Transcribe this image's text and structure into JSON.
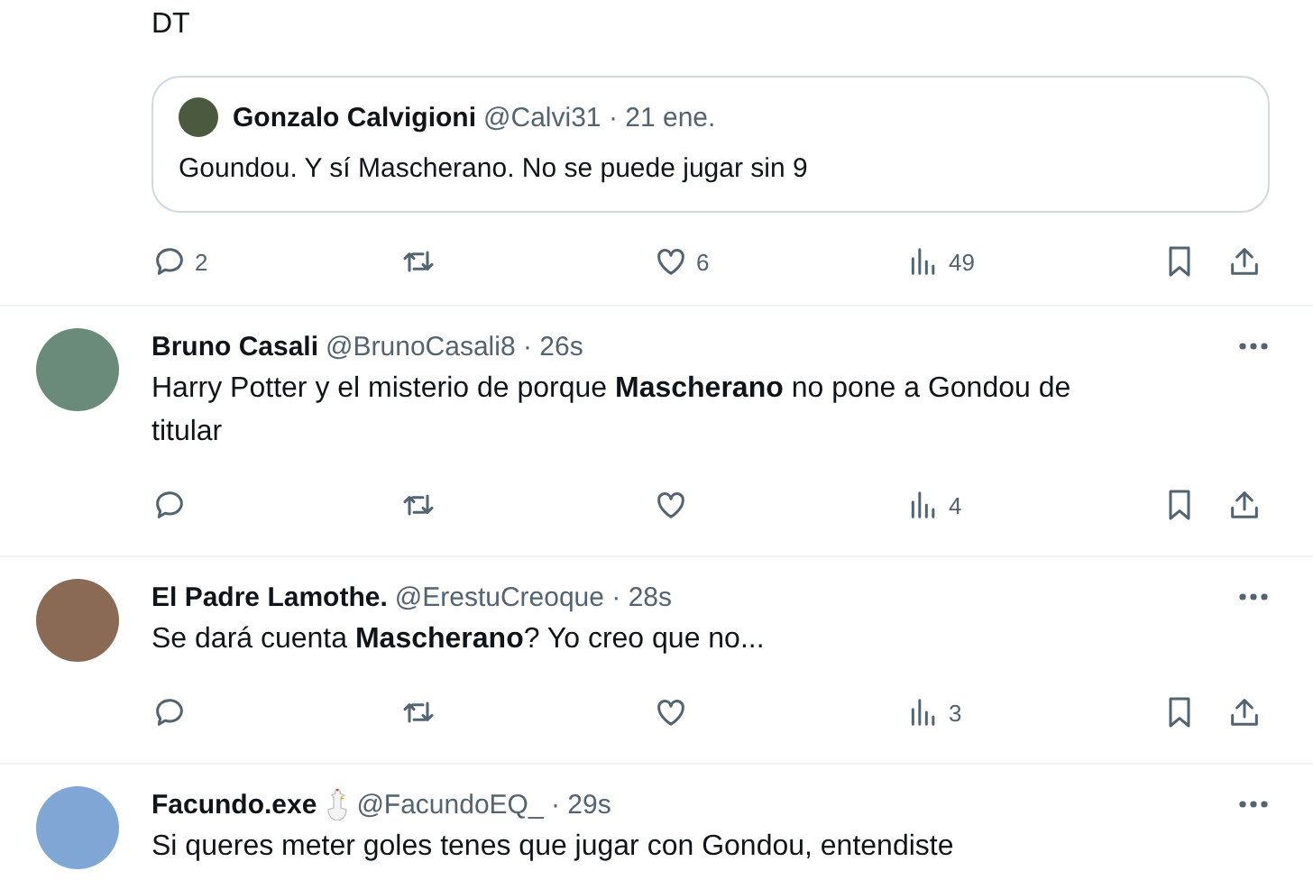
{
  "tweets": [
    {
      "text": "DT",
      "quote": {
        "name": "Gonzalo Calvigioni",
        "handle": "@Calvi31",
        "dot": "·",
        "time": "21 ene.",
        "text": "Goundou. Y sí Mascherano. No se puede jugar sin 9"
      },
      "stats": {
        "replies": "2",
        "likes": "6",
        "views": "49"
      }
    },
    {
      "avatar": true,
      "name": "Bruno Casali",
      "handle": "@BrunoCasali8",
      "dot": "·",
      "time": "26s",
      "text": "Harry Potter y el misterio de porque **Mascherano** no pone a Gondou de titular",
      "stats": {
        "views": "4"
      }
    },
    {
      "avatar": true,
      "name": "El Padre Lamothe.",
      "handle": "@ErestuCreoque",
      "dot": "·",
      "time": "28s",
      "text": "Se dará cuenta **Mascherano**? Yo creo que no...",
      "stats": {
        "views": "3"
      }
    },
    {
      "avatar": true,
      "name": "Facundo.exe",
      "badge": true,
      "handle": "@FacundoEQ_",
      "dot": "·",
      "time": "29s",
      "text": "Si queres meter goles tenes que jugar con Gondou, entendiste"
    }
  ]
}
